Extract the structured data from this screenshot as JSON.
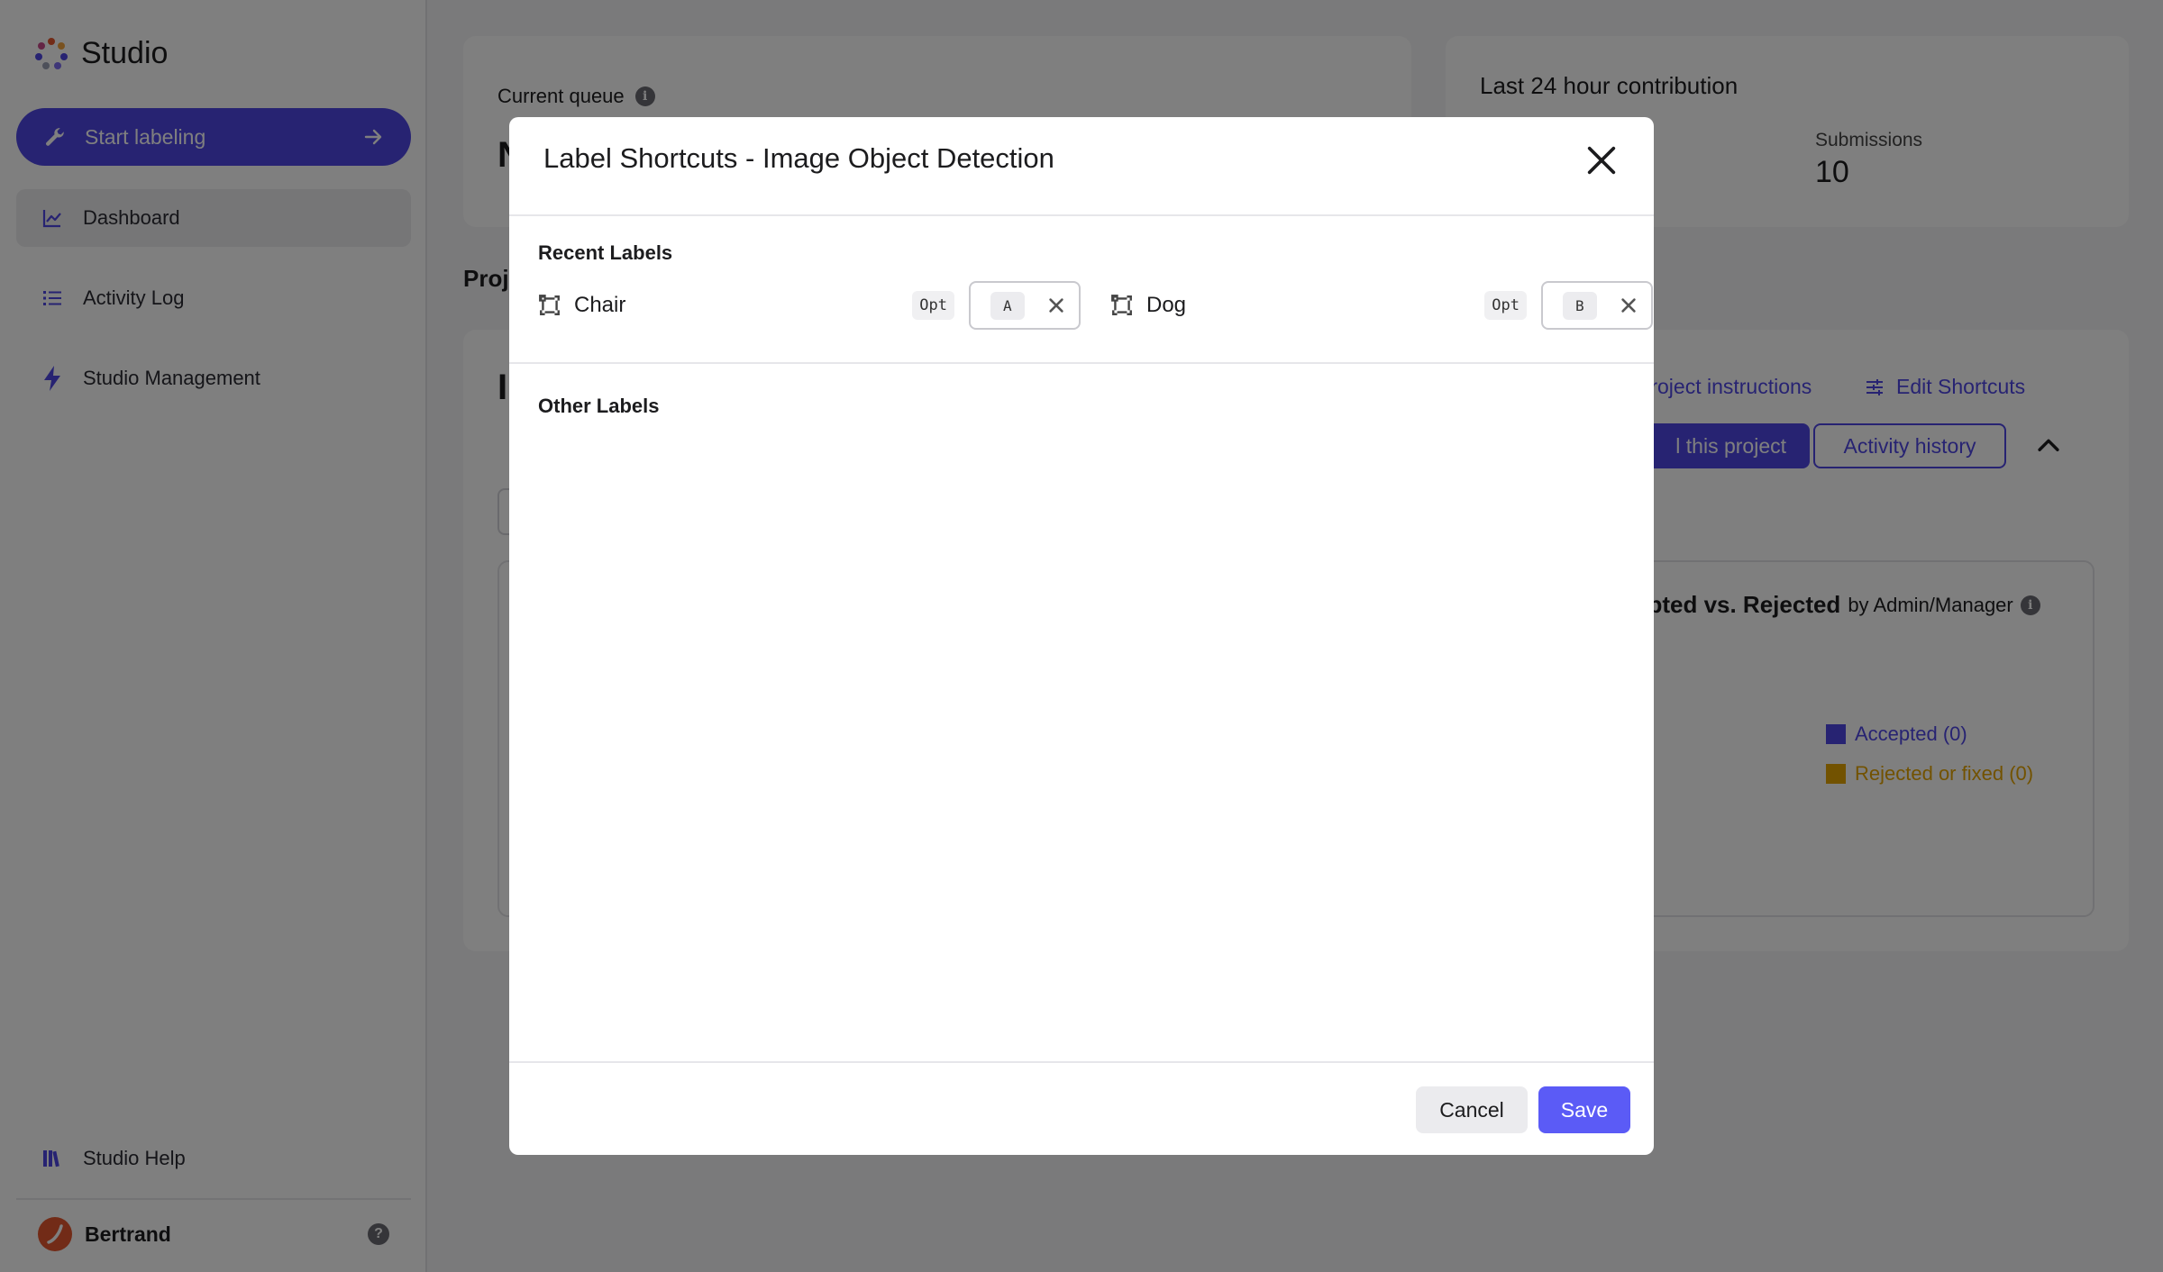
{
  "sidebar": {
    "brand": "Studio",
    "start_button": "Start labeling",
    "items": [
      {
        "label": "Dashboard",
        "icon": "chart-line-icon",
        "active": true
      },
      {
        "label": "Activity Log",
        "icon": "list-icon",
        "active": false
      },
      {
        "label": "Studio Management",
        "icon": "lightning-icon",
        "active": false
      }
    ],
    "help": "Studio Help",
    "user": "Bertrand",
    "help_badge": "?"
  },
  "main": {
    "queue": {
      "title": "Current queue",
      "value": "N"
    },
    "contribution": {
      "title": "Last 24 hour contribution",
      "submissions_label": "Submissions",
      "submissions_value": "10"
    },
    "projects_heading": "Proj",
    "project": {
      "title_initial": "I",
      "instructions_link": "Project instructions",
      "edit_shortcuts_link": "Edit Shortcuts",
      "label_project_button": "l this project",
      "activity_history_button": "Activity history",
      "chart": {
        "title": "epted vs. Rejected",
        "subtitle": "by Admin/Manager",
        "legend": [
          {
            "label": "Accepted (0)",
            "color": "#4f46e5"
          },
          {
            "label": "Rejected or fixed (0)",
            "color": "#e5a400"
          }
        ]
      }
    }
  },
  "modal": {
    "title": "Label Shortcuts - Image Object Detection",
    "recent_heading": "Recent Labels",
    "recent_labels": [
      {
        "name": "Chair",
        "modifier": "Opt",
        "key": "A",
        "icon": "bounding-box-icon"
      },
      {
        "name": "Dog",
        "modifier": "Opt",
        "key": "B",
        "icon": "bounding-box-icon"
      }
    ],
    "other_heading": "Other Labels",
    "cancel": "Cancel",
    "save": "Save"
  },
  "colors": {
    "accent": "#4f46e5",
    "save_button": "#5b5bf6",
    "rejected": "#e5a400",
    "overlay": "rgba(0,0,0,0.5)"
  }
}
